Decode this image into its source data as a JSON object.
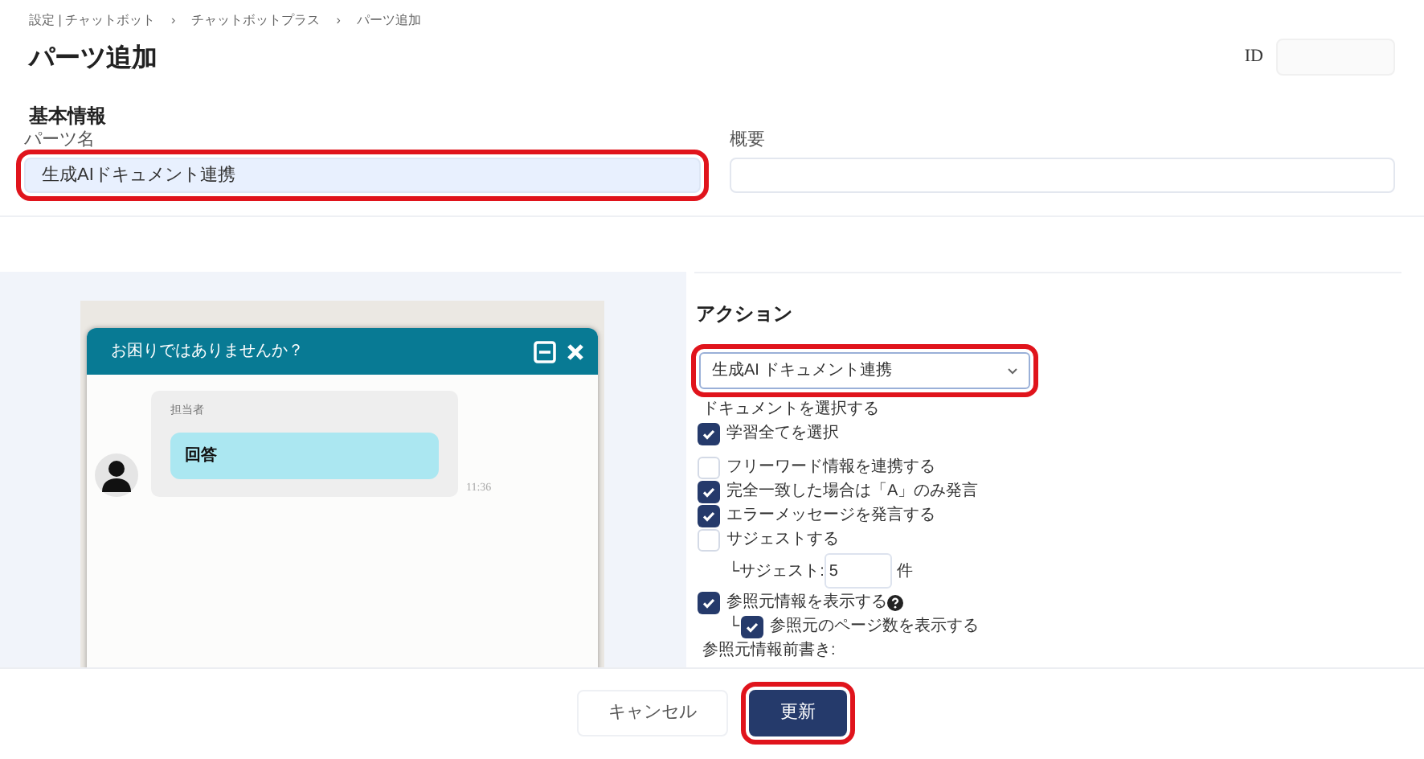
{
  "breadcrumb": [
    "設定 | チャットボット",
    "チャットボットプラス",
    "パーツ追加"
  ],
  "breadcrumb_separator": "›",
  "title": "パーツ追加",
  "id_field": {
    "label": "ID"
  },
  "basic_info": {
    "heading": "基本情報",
    "parts_name": {
      "label": "パーツ名",
      "value": "生成AIドキュメント連携",
      "highlighted": true
    },
    "summary": {
      "label": "概要"
    }
  },
  "chat_preview": {
    "header": "お困りではありませんか？",
    "sender": "担当者",
    "message": "回答",
    "time": "11:36"
  },
  "action": {
    "heading": "アクション",
    "select": {
      "value": "生成AI ドキュメント連携",
      "highlighted": true
    },
    "options": [
      {
        "kind": "label",
        "text": "ドキュメントを選択する"
      },
      {
        "kind": "checkbox",
        "label": "学習全てを選択",
        "checked": true
      },
      {
        "kind": "checkbox",
        "label": "フリーワード情報を連携する",
        "checked": false
      },
      {
        "kind": "checkbox",
        "label": "完全一致した場合は「A」のみ発言",
        "checked": true
      },
      {
        "kind": "checkbox",
        "label": "エラーメッセージを発言する",
        "checked": true
      },
      {
        "kind": "checkbox",
        "label": "サジェストする",
        "checked": false
      },
      {
        "kind": "count",
        "prefix": "└サジェスト:",
        "value": "5",
        "unit": "件"
      },
      {
        "kind": "checkbox",
        "label": "参照元情報を表示する",
        "checked": true,
        "help": true
      },
      {
        "kind": "checkbox",
        "label": "参照元のページ数を表示する",
        "checked": true,
        "prefix": "└"
      },
      {
        "kind": "label",
        "text": "参照元情報前書き:"
      }
    ]
  },
  "buttons": [
    {
      "label": "キャンセル",
      "kind": "secondary",
      "highlighted": false
    },
    {
      "label": "更新",
      "kind": "primary",
      "highlighted": true
    }
  ]
}
